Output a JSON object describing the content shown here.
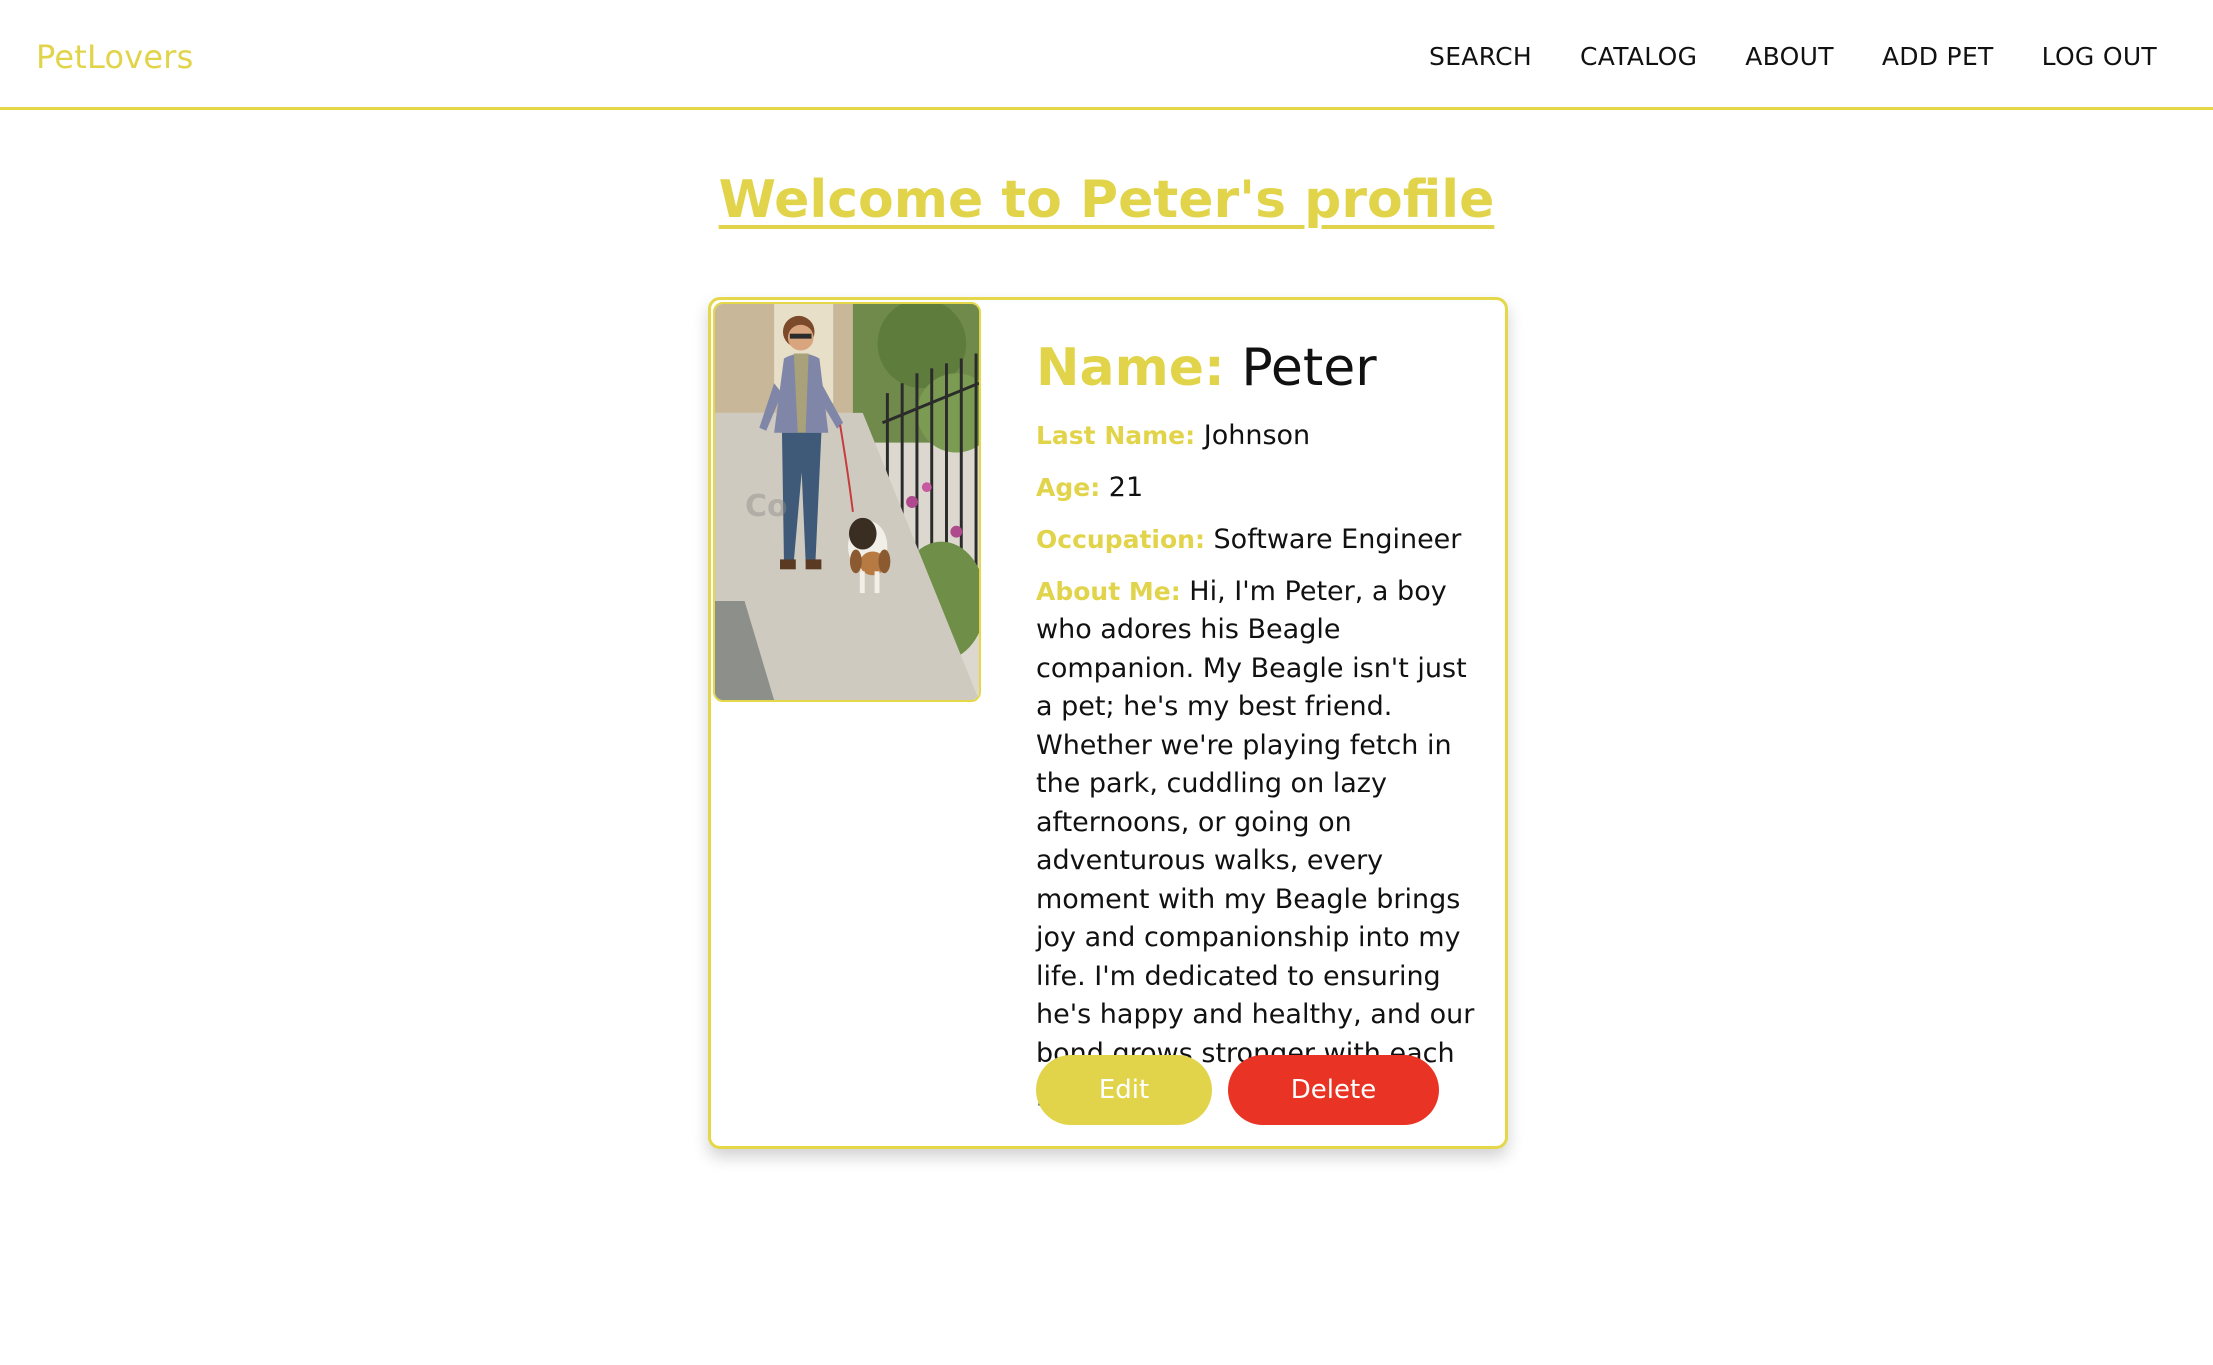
{
  "header": {
    "brand": "PetLovers",
    "nav": [
      "SEARCH",
      "CATALOG",
      "ABOUT",
      "ADD PET",
      "LOG OUT"
    ]
  },
  "page": {
    "title": "Welcome to Peter's profile"
  },
  "profile": {
    "name_label": "Name:",
    "name": "Peter",
    "last_name_label": "Last Name:",
    "last_name": "Johnson",
    "age_label": "Age:",
    "age": "21",
    "occupation_label": "Occupation:",
    "occupation": "Software Engineer",
    "about_label": "About Me:",
    "about": "Hi, I'm Peter, a boy who adores his Beagle companion. My Beagle isn't just a pet; he's my best friend. Whether we're playing fetch in the park, cuddling on lazy afternoons, or going on adventurous walks, every moment with my Beagle brings joy and companionship into my life. I'm dedicated to ensuring he's happy and healthy, and our bond grows stronger with each passing day.",
    "photo_watermark": "Co"
  },
  "actions": {
    "edit": "Edit",
    "delete": "Delete"
  },
  "colors": {
    "accent": "#e2d44a",
    "danger": "#e93324",
    "text": "#111111"
  }
}
